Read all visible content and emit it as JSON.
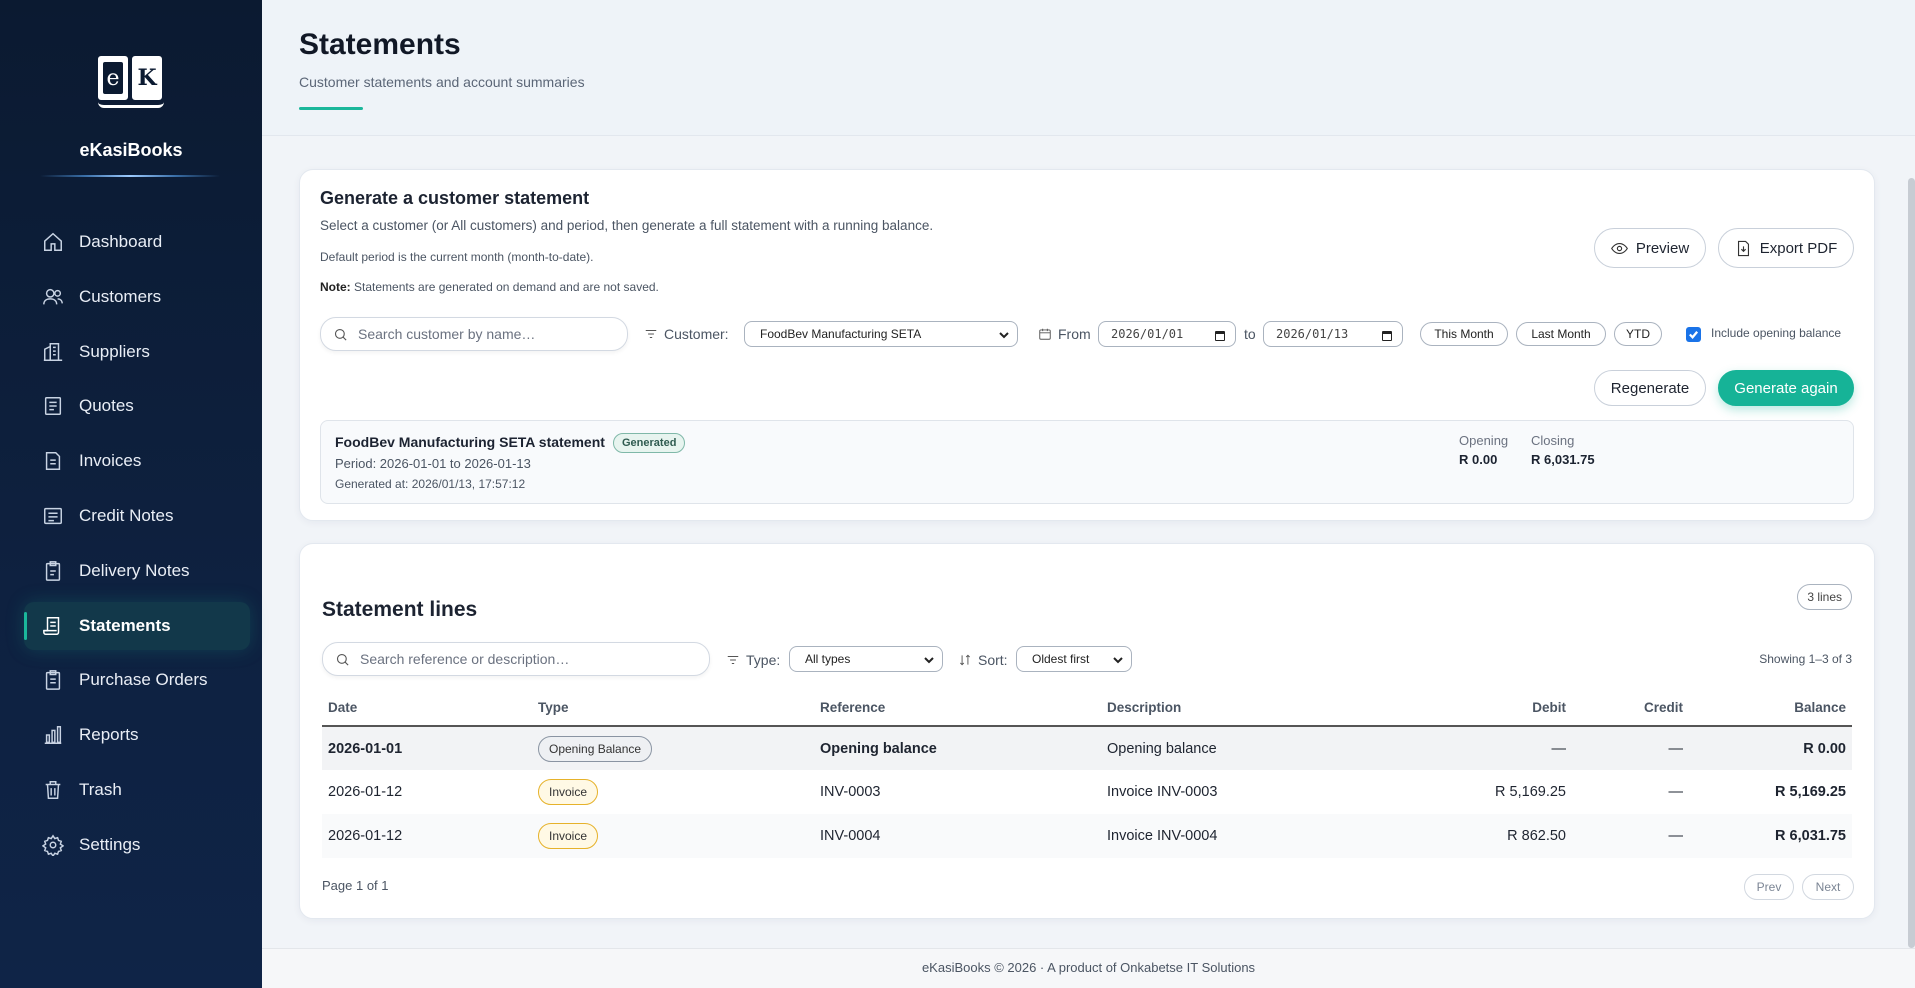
{
  "app": {
    "name": "eKasiBooks"
  },
  "sidebar": {
    "items": [
      {
        "label": "Dashboard",
        "icon": "home-icon"
      },
      {
        "label": "Customers",
        "icon": "users-icon"
      },
      {
        "label": "Suppliers",
        "icon": "building-icon"
      },
      {
        "label": "Quotes",
        "icon": "quote-doc-icon"
      },
      {
        "label": "Invoices",
        "icon": "invoice-doc-icon"
      },
      {
        "label": "Credit Notes",
        "icon": "credit-note-icon"
      },
      {
        "label": "Delivery Notes",
        "icon": "clipboard-icon"
      },
      {
        "label": "Statements",
        "icon": "statement-icon",
        "active": true
      },
      {
        "label": "Purchase Orders",
        "icon": "purchase-order-icon"
      },
      {
        "label": "Reports",
        "icon": "bar-chart-icon"
      },
      {
        "label": "Trash",
        "icon": "trash-icon"
      },
      {
        "label": "Settings",
        "icon": "gear-icon"
      }
    ]
  },
  "header": {
    "title": "Statements",
    "subtitle": "Customer statements and account summaries"
  },
  "generate": {
    "title": "Generate a customer statement",
    "description": "Select a customer (or All customers) and period, then generate a full statement with a running balance.",
    "note_default": "Default period is the current month (month-to-date).",
    "note_label": "Note:",
    "note_text": " Statements are generated on demand and are not saved.",
    "preview_label": "Preview",
    "export_label": "Export PDF",
    "search_placeholder": "Search customer by name…",
    "customer_label": "Customer:",
    "customer_value": "FoodBev Manufacturing SETA",
    "from_label": "From",
    "from_value": "2026/01/01",
    "to_label": "to",
    "to_value": "2026/01/13",
    "this_month_label": "This Month",
    "last_month_label": "Last Month",
    "ytd_label": "YTD",
    "include_opening_label": "Include opening balance",
    "include_opening_checked": true,
    "regenerate_label": "Regenerate",
    "generate_again_label": "Generate again"
  },
  "result": {
    "title": "FoodBev Manufacturing SETA statement",
    "badge": "Generated",
    "period": "Period: 2026-01-01 to 2026-01-13",
    "generated_at": "Generated at: 2026/01/13, 17:57:12",
    "opening_label": "Opening",
    "opening_value": "R 0.00",
    "closing_label": "Closing",
    "closing_value": "R 6,031.75"
  },
  "lines": {
    "title": "Statement lines",
    "count_label": "3 lines",
    "search_placeholder": "Search reference or description…",
    "type_label": "Type:",
    "type_value": "All types",
    "sort_label": "Sort:",
    "sort_value": "Oldest first",
    "showing": "Showing 1–3 of 3",
    "columns": {
      "date": "Date",
      "type": "Type",
      "reference": "Reference",
      "description": "Description",
      "debit": "Debit",
      "credit": "Credit",
      "balance": "Balance"
    },
    "rows": [
      {
        "date": "2026-01-01",
        "type": "Opening Balance",
        "reference": "Opening balance",
        "description": "Opening balance",
        "debit": "—",
        "credit": "—",
        "balance": "R 0.00"
      },
      {
        "date": "2026-01-12",
        "type": "Invoice",
        "reference": "INV-0003",
        "description": "Invoice INV-0003",
        "debit": "R 5,169.25",
        "credit": "—",
        "balance": "R 5,169.25"
      },
      {
        "date": "2026-01-12",
        "type": "Invoice",
        "reference": "INV-0004",
        "description": "Invoice INV-0004",
        "debit": "R 862.50",
        "credit": "—",
        "balance": "R 6,031.75"
      }
    ],
    "page_info": "Page 1 of 1",
    "prev_label": "Prev",
    "next_label": "Next"
  },
  "footer": {
    "text": "eKasiBooks © 2026 · A product of Onkabetse IT Solutions"
  },
  "colors": {
    "accent": "#16b397",
    "sidebar_bg": "#0b1a31"
  }
}
